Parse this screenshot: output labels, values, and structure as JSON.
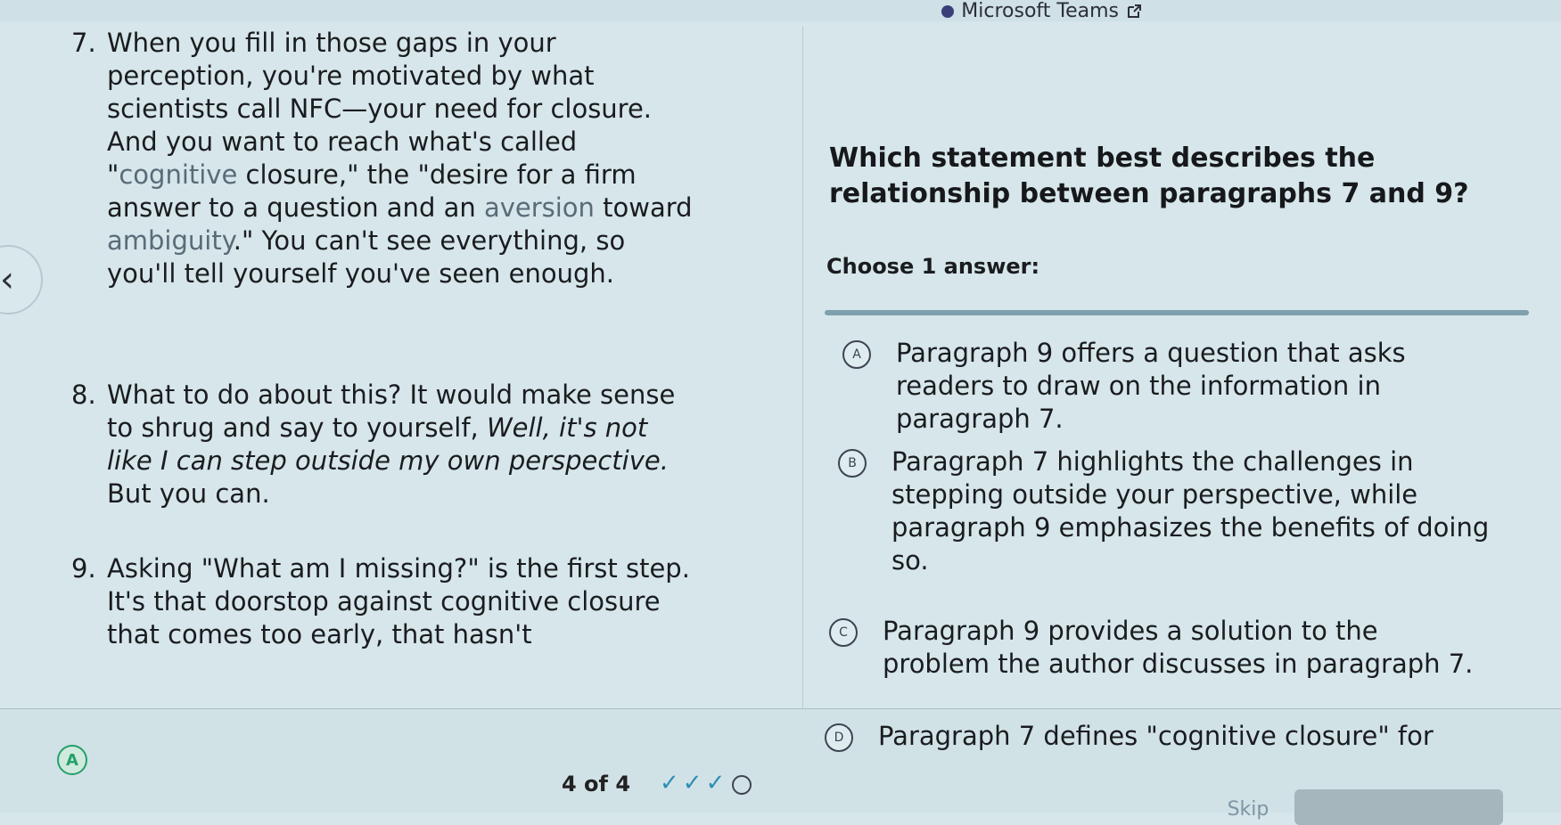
{
  "topbar": {
    "app_link": "Microsoft Teams"
  },
  "passage": {
    "paragraphs": [
      {
        "number": "7.",
        "segments": [
          "When you fill in those gaps in your perception, you're motivated by what scientists call NFC—your need for closure. And you want to reach what's called \"",
          "cognitive",
          " closure,\" the \"desire for a firm answer to a question and an ",
          "aversion",
          " toward ",
          "ambiguity",
          ".\" You can't see everything, so you'll tell yourself you've seen enough."
        ]
      },
      {
        "number": "8.",
        "text_before": "What to do about this? It would make sense to shrug and say to yourself, ",
        "italic": "Well, it's not like I can step outside my own perspective.",
        "text_after": " But you can."
      },
      {
        "number": "9.",
        "text": "Asking \"What am I missing?\" is the first step. It's that doorstop against cognitive closure that comes too early, that hasn't"
      }
    ]
  },
  "question": {
    "prompt": "Which statement best describes the relationship between paragraphs 7 and 9?",
    "choose_label": "Choose 1 answer:",
    "choices": [
      {
        "letter": "A",
        "text": "Paragraph 9 offers a question that asks readers to draw on the information in paragraph 7."
      },
      {
        "letter": "B",
        "text": "Paragraph 7 highlights the challenges in stepping outside your perspective, while paragraph 9 emphasizes the benefits of doing so."
      },
      {
        "letter": "C",
        "text": "Paragraph 9 provides a solution to the problem the author discusses in paragraph 7."
      },
      {
        "letter": "D",
        "text": "Paragraph 7 defines \"cognitive closure\" for"
      }
    ]
  },
  "footer": {
    "passage_marker": "A",
    "progress": "4 of 4",
    "skip_label": "Skip"
  }
}
